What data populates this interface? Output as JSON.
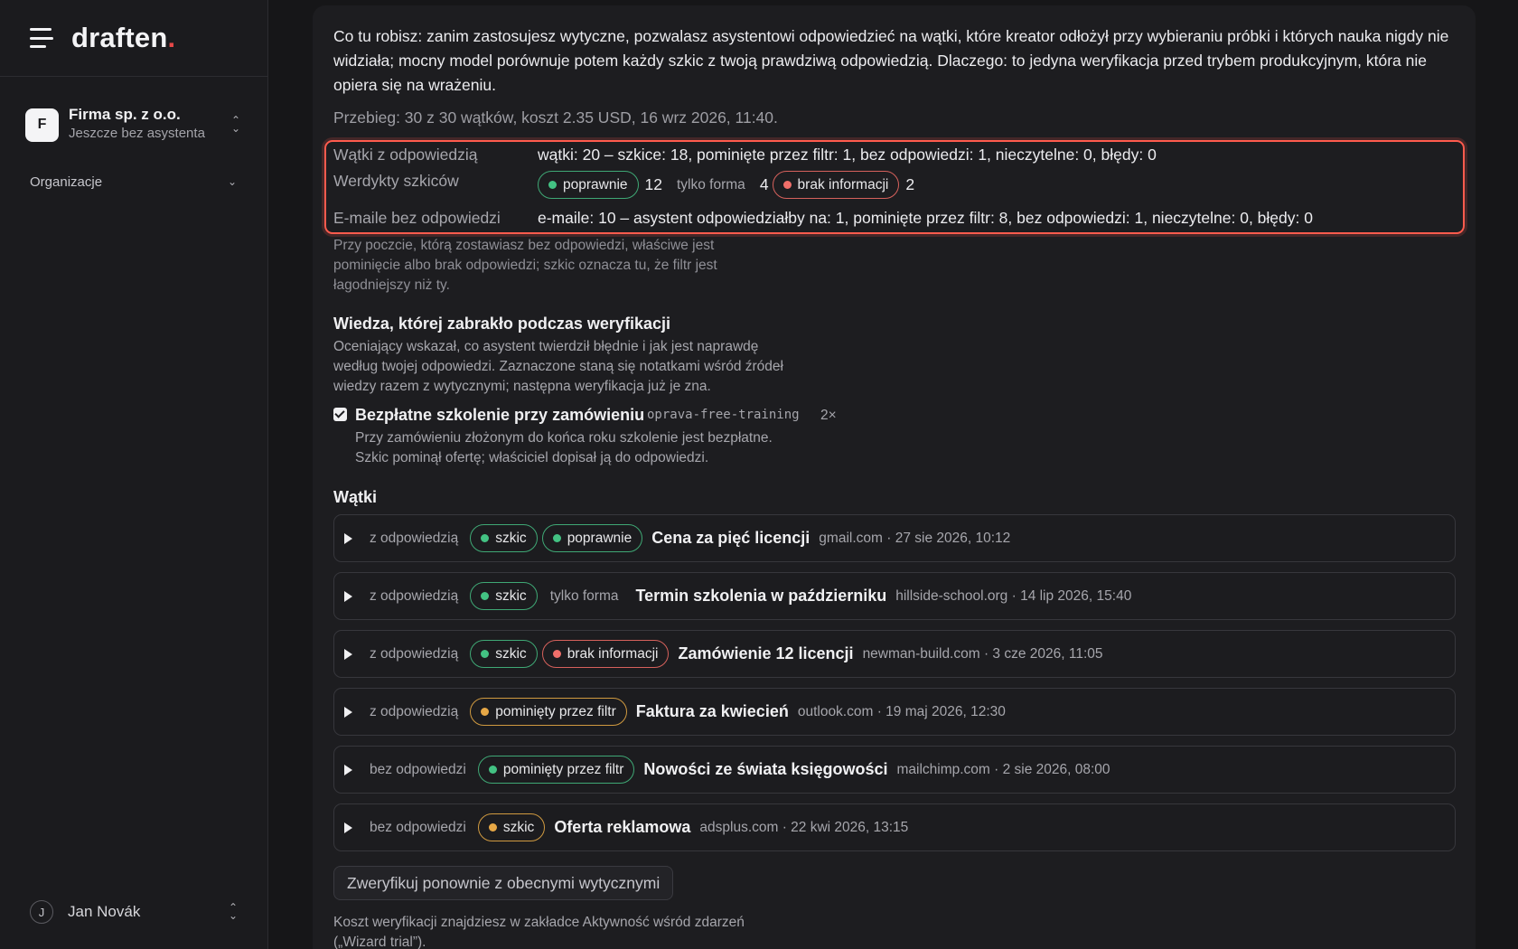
{
  "app": {
    "logo_text": "draften",
    "logo_dot": "."
  },
  "sidebar": {
    "org": {
      "avatar_letter": "F",
      "name": "Firma sp. z o.o.",
      "subtitle": "Jeszcze bez asystenta"
    },
    "section_label": "Organizacje",
    "user": {
      "avatar_letter": "J",
      "name": "Jan Novák"
    }
  },
  "main": {
    "intro": "Co tu robisz: zanim zastosujesz wytyczne, pozwalasz asystentowi odpowiedzieć na wątki, które kreator odłożył przy wybieraniu próbki i których nauka nigdy nie widziała; mocny model porównuje potem każdy szkic z twoją prawdziwą odpowiedzią. Dlaczego: to jedyna weryfikacja przed trybem produkcyjnym, która nie opiera się na wrażeniu.",
    "run_meta": "Przebieg: 30 z 30 wątków, koszt 2.35 USD, 16 wrz 2026, 11:40.",
    "summary": {
      "replied_label": "Wątki z odpowiedzią",
      "replied_value": "wątki: 20 – szkice: 18, pominięte przez filtr: 1, bez odpowiedzi: 1, nieczytelne: 0, błędy: 0",
      "verdicts_label": "Werdykty szkiców",
      "verdicts": {
        "correct_label": "poprawnie",
        "correct_count": "12",
        "form_label": "tylko forma",
        "form_count": "4",
        "missing_label": "brak informacji",
        "missing_count": "2"
      },
      "unreplied_label": "E-maile bez odpowiedzi",
      "unreplied_value": "e-maile: 10 – asystent odpowiedziałby na: 1, pominięte przez filtr: 8, bez odpowiedzi: 1, nieczytelne: 0, błędy: 0"
    },
    "note": "Przy poczcie, którą zostawiasz bez odpowiedzi, właściwe jest pominięcie albo brak odpowiedzi; szkic oznacza tu, że filtr jest łagodniejszy niż ty.",
    "knowledge": {
      "title": "Wiedza, której zabrakło podczas weryfikacji",
      "description": "Oceniający wskazał, co asystent twierdził błędnie i jak jest naprawdę według twojej odpowiedzi. Zaznaczone staną się notatkami wśród źródeł wiedzy razem z wytycznymi; następna weryfikacja już je zna.",
      "item": {
        "checked": true,
        "title": "Bezpłatne szkolenie przy zamówieniu",
        "code": "oprava-free-training",
        "count": "2×",
        "description": "Przy zamówieniu złożonym do końca roku szkolenie jest bezpłatne. Szkic pominął ofertę; właściciel dopisał ją do odpowiedzi."
      }
    },
    "threads_title": "Wątki",
    "threads": [
      {
        "state": "z odpowiedzią",
        "badges": [
          {
            "label": "szkic",
            "color": "green"
          },
          {
            "label": "poprawnie",
            "color": "green"
          }
        ],
        "plain": "",
        "subject": "Cena za pięć licencji",
        "meta": "gmail.com · 27 sie 2026, 10:12"
      },
      {
        "state": "z odpowiedzią",
        "badges": [
          {
            "label": "szkic",
            "color": "green"
          }
        ],
        "plain": "tylko forma",
        "subject": "Termin szkolenia w październiku",
        "meta": "hillside-school.org · 14 lip 2026, 15:40"
      },
      {
        "state": "z odpowiedzią",
        "badges": [
          {
            "label": "szkic",
            "color": "green"
          },
          {
            "label": "brak informacji",
            "color": "red"
          }
        ],
        "plain": "",
        "subject": "Zamówienie 12 licencji",
        "meta": "newman-build.com · 3 cze 2026, 11:05"
      },
      {
        "state": "z odpowiedzią",
        "badges": [
          {
            "label": "pominięty przez filtr",
            "color": "amber"
          }
        ],
        "plain": "",
        "subject": "Faktura za kwiecień",
        "meta": "outlook.com · 19 maj 2026, 12:30"
      },
      {
        "state": "bez odpowiedzi",
        "badges": [
          {
            "label": "pominięty przez filtr",
            "color": "green"
          }
        ],
        "plain": "",
        "subject": "Nowości ze świata księgowości",
        "meta": "mailchimp.com · 2 sie 2026, 08:00"
      },
      {
        "state": "bez odpowiedzi",
        "badges": [
          {
            "label": "szkic",
            "color": "amber"
          }
        ],
        "plain": "",
        "subject": "Oferta reklamowa",
        "meta": "adsplus.com · 22 kwi 2026, 13:15"
      }
    ],
    "reverify_button": "Zweryfikuj ponownie z obecnymi wytycznymi",
    "footer_note": "Koszt weryfikacji znajdziesz w zakładce Aktywność wśród zdarzeń („Wizard trial”)."
  },
  "colors": {
    "accent_red": "#e54848",
    "highlight": "#ff5b4d",
    "green": "#43c283",
    "red": "#f06f6a",
    "amber": "#e7a846"
  }
}
